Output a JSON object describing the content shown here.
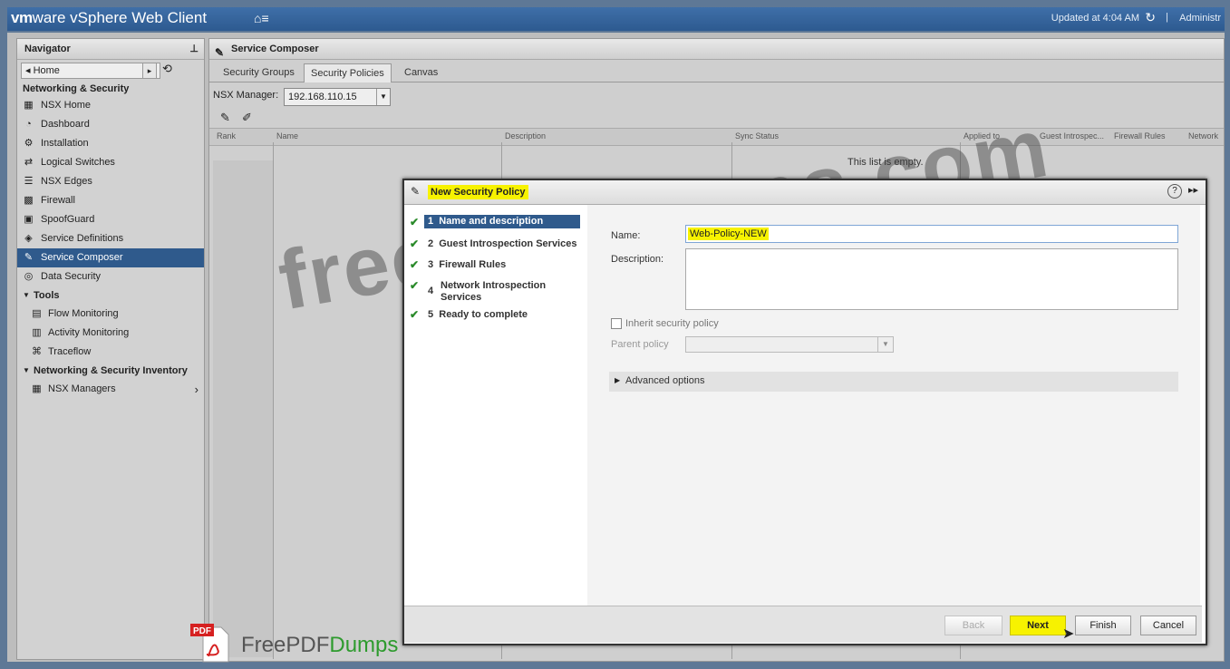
{
  "app": {
    "brand_vm": "vm",
    "brand_ware": "ware",
    "brand_rest": " vSphere Web Client",
    "home_menu": "⌂≡",
    "updated": "Updated at 4:04 AM",
    "refresh": "↻",
    "separator": "|",
    "admin": "Administr"
  },
  "navigator": {
    "title": "Navigator",
    "pin": "⊥",
    "home": "◂ Home",
    "section": "Networking & Security",
    "items": [
      {
        "label": "NSX Home",
        "icon": "nsx-home-icon",
        "glyph": "▦"
      },
      {
        "label": "Dashboard",
        "icon": "dashboard-icon",
        "glyph": "◔"
      },
      {
        "label": "Installation",
        "icon": "installation-icon",
        "glyph": "⚙"
      },
      {
        "label": "Logical Switches",
        "icon": "logical-switch-icon",
        "glyph": "⇄"
      },
      {
        "label": "NSX Edges",
        "icon": "edge-icon",
        "glyph": "☰"
      },
      {
        "label": "Firewall",
        "icon": "firewall-icon",
        "glyph": "▩"
      },
      {
        "label": "SpoofGuard",
        "icon": "spoofguard-icon",
        "glyph": "▣"
      },
      {
        "label": "Service Definitions",
        "icon": "service-def-icon",
        "glyph": "◈"
      },
      {
        "label": "Service Composer",
        "icon": "service-composer-icon",
        "glyph": "✎"
      },
      {
        "label": "Data Security",
        "icon": "data-security-icon",
        "glyph": "◎"
      }
    ],
    "tools_label": "Tools",
    "tools": [
      {
        "label": "Flow Monitoring",
        "icon": "flow-monitoring-icon",
        "glyph": "▤"
      },
      {
        "label": "Activity Monitoring",
        "icon": "activity-monitoring-icon",
        "glyph": "▥"
      },
      {
        "label": "Traceflow",
        "icon": "traceflow-icon",
        "glyph": "⌘"
      }
    ],
    "inventory_label": "Networking & Security Inventory",
    "inventory": [
      {
        "label": "NSX Managers",
        "icon": "nsx-managers-icon",
        "glyph": "▦"
      }
    ]
  },
  "main": {
    "title": "Service Composer",
    "tabs": [
      "Security Groups",
      "Security Policies",
      "Canvas"
    ],
    "active_tab": "Security Policies",
    "manager_label": "NSX Manager:",
    "manager_value": "192.168.110.15",
    "columns": [
      "Rank",
      "Name",
      "Description",
      "Sync Status",
      "Applied to",
      "Guest Introspec...",
      "Firewall Rules",
      "Network"
    ],
    "empty_text": "This list is empty."
  },
  "dialog": {
    "title": "New Security Policy",
    "help": "?",
    "expand": "▸▸",
    "steps": [
      {
        "num": "1",
        "label": "Name and description"
      },
      {
        "num": "2",
        "label": "Guest Introspection Services"
      },
      {
        "num": "3",
        "label": "Firewall Rules"
      },
      {
        "num": "4",
        "label": "Network Introspection Services"
      },
      {
        "num": "5",
        "label": "Ready to complete"
      }
    ],
    "name_label": "Name:",
    "name_value": "Web-Policy-NEW",
    "description_label": "Description:",
    "inherit_label": "Inherit security policy",
    "parent_label": "Parent policy",
    "advanced_label": "Advanced options",
    "buttons": {
      "back": "Back",
      "next": "Next",
      "finish": "Finish",
      "cancel": "Cancel"
    }
  },
  "watermark": "freepdfdumps.com",
  "logo": {
    "badge": "PDF",
    "part1": "FreePDF",
    "part2": "Dumps"
  },
  "colors": {
    "accent": "#2f5a8c",
    "highlight": "#f7f200",
    "check": "#2a8a2a",
    "topbar": "#3f6fa8"
  }
}
